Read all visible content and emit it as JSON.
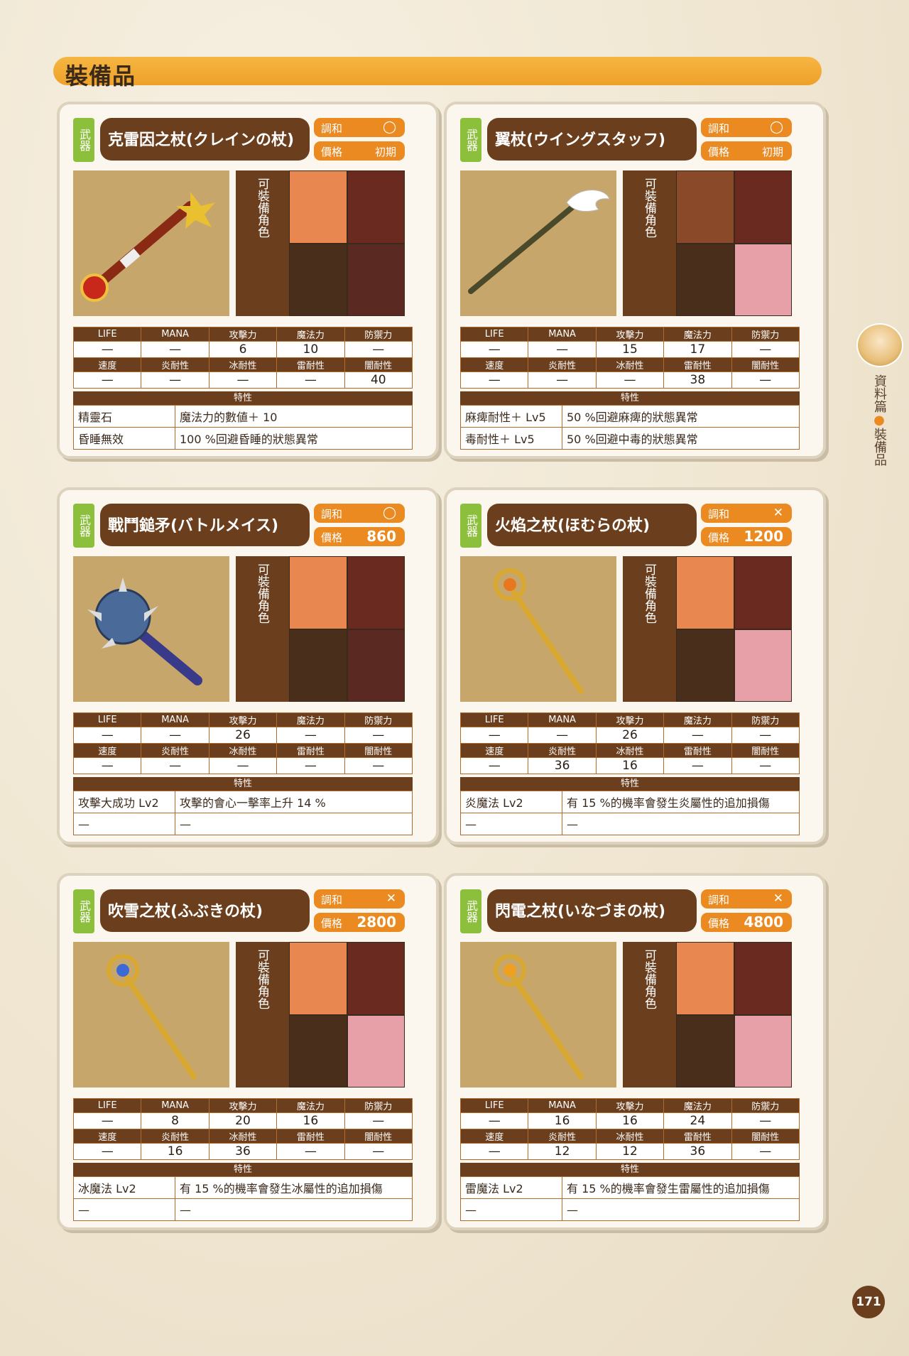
{
  "section_title": "裝備品",
  "side_tab": {
    "part1": "資料篇",
    "part2": "裝備品"
  },
  "page_number": "171",
  "category": "武器",
  "labels": {
    "harmony": "調和",
    "price": "價格",
    "equippable": "可裝備角色",
    "life": "LIFE",
    "mana": "MANA",
    "atk": "攻擊力",
    "mag": "魔法力",
    "def": "防禦力",
    "spd": "速度",
    "fire": "炎耐性",
    "ice": "冰耐性",
    "thunder": "雷耐性",
    "dark": "闇耐性",
    "traits": "特性"
  },
  "cards": [
    {
      "name": "克雷因之杖(クレインの杖)",
      "harmony": "◯",
      "price": "初期",
      "row1": [
        "—",
        "—",
        "6",
        "10",
        "—"
      ],
      "row2": [
        "—",
        "—",
        "—",
        "—",
        "40"
      ],
      "traits": [
        {
          "k": "精靈石",
          "v": "魔法力的數値＋ 10"
        },
        {
          "k": "昏睡無效",
          "v": "100 %回避昏睡的狀態異常"
        }
      ]
    },
    {
      "name": "翼杖(ウイングスタッフ)",
      "harmony": "◯",
      "price": "初期",
      "row1": [
        "—",
        "—",
        "15",
        "17",
        "—"
      ],
      "row2": [
        "—",
        "—",
        "—",
        "38",
        "—"
      ],
      "traits": [
        {
          "k": "麻痺耐性＋ Lv5",
          "v": "50 %回避麻痺的狀態異常"
        },
        {
          "k": "毒耐性＋ Lv5",
          "v": "50 %回避中毒的狀態異常"
        }
      ]
    },
    {
      "name": "戰鬥鎚矛(バトルメイス)",
      "harmony": "◯",
      "price": "860",
      "row1": [
        "—",
        "—",
        "26",
        "—",
        "—"
      ],
      "row2": [
        "—",
        "—",
        "—",
        "—",
        "—"
      ],
      "traits": [
        {
          "k": "攻擊大成功 Lv2",
          "v": "攻擊的會心一擊率上升 14 %"
        },
        {
          "k": "—",
          "v": "—"
        }
      ]
    },
    {
      "name": "火焰之杖(ほむらの杖)",
      "harmony": "✕",
      "price": "1200",
      "row1": [
        "—",
        "—",
        "26",
        "—",
        "—"
      ],
      "row2": [
        "—",
        "36",
        "16",
        "—",
        "—"
      ],
      "traits": [
        {
          "k": "炎魔法 Lv2",
          "v": "有 15 %的機率會發生炎屬性的追加損傷"
        },
        {
          "k": "—",
          "v": "—"
        }
      ]
    },
    {
      "name": "吹雪之杖(ふぶきの杖)",
      "harmony": "✕",
      "price": "2800",
      "row1": [
        "—",
        "8",
        "20",
        "16",
        "—"
      ],
      "row2": [
        "—",
        "16",
        "36",
        "—",
        "—"
      ],
      "traits": [
        {
          "k": "冰魔法 Lv2",
          "v": "有 15 %的機率會發生冰屬性的追加損傷"
        },
        {
          "k": "—",
          "v": "—"
        }
      ]
    },
    {
      "name": "閃電之杖(いなづまの杖)",
      "harmony": "✕",
      "price": "4800",
      "row1": [
        "—",
        "16",
        "16",
        "24",
        "—"
      ],
      "row2": [
        "—",
        "12",
        "12",
        "36",
        "—"
      ],
      "traits": [
        {
          "k": "雷魔法 Lv2",
          "v": "有 15 %的機率會發生雷屬性的追加損傷"
        },
        {
          "k": "—",
          "v": "—"
        }
      ]
    }
  ]
}
